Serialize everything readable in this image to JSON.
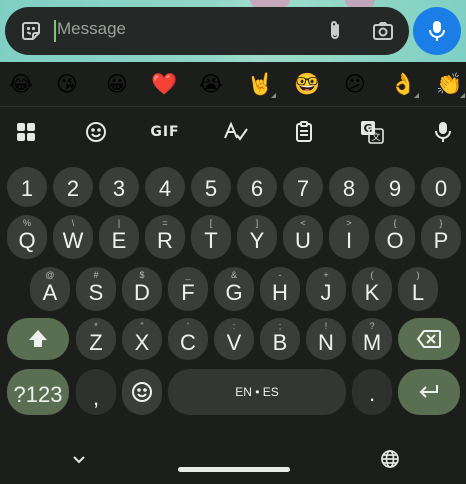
{
  "message_bar": {
    "placeholder": "Message",
    "sticker_icon": "sticker-smiley-icon",
    "attach_icon": "paperclip-icon",
    "camera_icon": "camera-icon",
    "mic_icon": "microphone-icon",
    "accent_color": "#1a7ee6"
  },
  "emoji_row": [
    "😂",
    "😘",
    "😀",
    "❤️",
    "😭",
    "🤘",
    "🤓",
    "😕",
    "👌",
    "👏"
  ],
  "toolbar": {
    "apps_icon": "apps-grid-icon",
    "emoji_icon": "emoji-face-icon",
    "gif_label": "GIF",
    "handwriting_icon": "handwriting-icon",
    "clipboard_icon": "clipboard-icon",
    "translate_icon": "translate-icon",
    "voice_icon": "microphone-icon"
  },
  "keyboard": {
    "numbers": [
      "1",
      "2",
      "3",
      "4",
      "5",
      "6",
      "7",
      "8",
      "9",
      "0"
    ],
    "row1": [
      {
        "key": "Q",
        "hint": "%"
      },
      {
        "key": "W",
        "hint": "\\"
      },
      {
        "key": "E",
        "hint": "|"
      },
      {
        "key": "R",
        "hint": "="
      },
      {
        "key": "T",
        "hint": "["
      },
      {
        "key": "Y",
        "hint": "]"
      },
      {
        "key": "U",
        "hint": "<"
      },
      {
        "key": "I",
        "hint": ">"
      },
      {
        "key": "O",
        "hint": "{"
      },
      {
        "key": "P",
        "hint": "}"
      }
    ],
    "row2": [
      {
        "key": "A",
        "hint": "@"
      },
      {
        "key": "S",
        "hint": "#"
      },
      {
        "key": "D",
        "hint": "$"
      },
      {
        "key": "F",
        "hint": "_"
      },
      {
        "key": "G",
        "hint": "&"
      },
      {
        "key": "H",
        "hint": "-"
      },
      {
        "key": "J",
        "hint": "+"
      },
      {
        "key": "K",
        "hint": "("
      },
      {
        "key": "L",
        "hint": ")"
      }
    ],
    "row3": [
      {
        "key": "Z",
        "hint": "*"
      },
      {
        "key": "X",
        "hint": "\""
      },
      {
        "key": "C",
        "hint": "'"
      },
      {
        "key": "V",
        "hint": ":"
      },
      {
        "key": "B",
        "hint": ";"
      },
      {
        "key": "N",
        "hint": "!"
      },
      {
        "key": "M",
        "hint": "?"
      }
    ],
    "symbols_label": "?123",
    "comma": ",",
    "space_label": "EN • ES",
    "period": ".",
    "shift_icon": "shift-arrow-icon",
    "backspace_icon": "backspace-icon",
    "enter_icon": "enter-arrow-icon",
    "emoji_key_icon": "emoji-face-icon",
    "accent_color": "#5a6e52"
  },
  "nav": {
    "hide_icon": "chevron-down-icon",
    "language_icon": "globe-icon"
  }
}
